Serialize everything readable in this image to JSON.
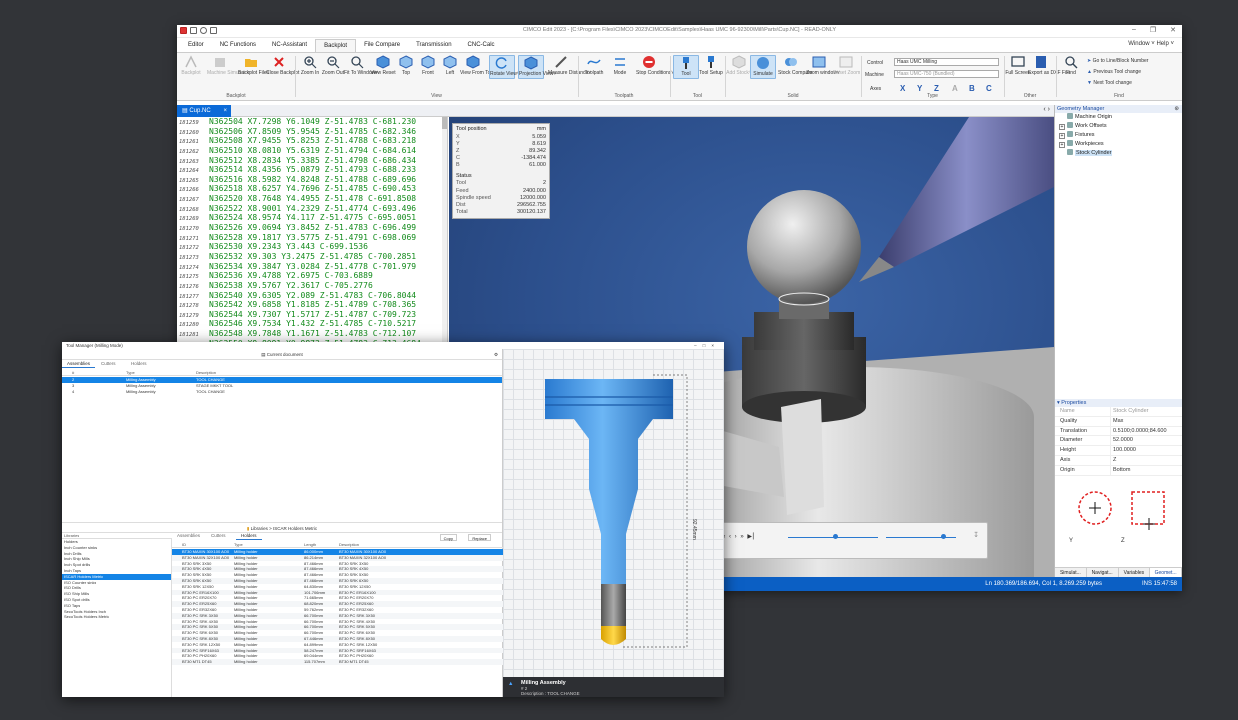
{
  "app": {
    "title": "CIMCO Edit 2023 - [C:\\Program Files\\CIMCO 2023\\CIMCOEdit\\Samples\\Haas UMC 96-92300\\Mill\\Parts\\Cup.NC] - READ-ONLY",
    "menu_tabs": [
      "Editor",
      "NC Functions",
      "NC-Assistant",
      "Backplot",
      "File Compare",
      "Transmission",
      "CNC-Calc"
    ],
    "active_tab": "Backplot",
    "menu_right": "Window ˅  Help ˅"
  },
  "ribbon": {
    "groups": [
      "Backplot",
      "View",
      "Toolpath",
      "Tool",
      "Solid",
      "Type",
      "Other",
      "Find"
    ],
    "buttons": [
      {
        "id": "backplot",
        "label": "Backplot",
        "dim": true
      },
      {
        "id": "machine-sim",
        "label": "Machine Simulation",
        "dim": true
      },
      {
        "id": "backplot-file",
        "label": "Backplot File˅"
      },
      {
        "id": "close-backplot",
        "label": "Close Backplot"
      },
      {
        "id": "zoom-in",
        "label": "Zoom In"
      },
      {
        "id": "zoom-out",
        "label": "Zoom Out"
      },
      {
        "id": "fit-window",
        "label": "Fit To Window˅"
      },
      {
        "id": "view-reset",
        "label": "View Reset"
      },
      {
        "id": "top",
        "label": "Top"
      },
      {
        "id": "front",
        "label": "Front"
      },
      {
        "id": "left",
        "label": "Left"
      },
      {
        "id": "view-from-tool",
        "label": "View From Tool"
      },
      {
        "id": "rotate-view",
        "label": "Rotate View˅"
      },
      {
        "id": "projection-view",
        "label": "Projection View˅"
      },
      {
        "id": "measure-distance",
        "label": "Measure Distance˅"
      },
      {
        "id": "toolpath",
        "label": "Toolpath"
      },
      {
        "id": "mode",
        "label": "Mode"
      },
      {
        "id": "stop-conditions",
        "label": "Stop Conditions˅"
      },
      {
        "id": "tool",
        "label": "Tool"
      },
      {
        "id": "tool-setup",
        "label": "Tool Setup"
      },
      {
        "id": "add-stock",
        "label": "Add Stock˅",
        "dim": true
      },
      {
        "id": "simulate",
        "label": "Simulate"
      },
      {
        "id": "stock-compare",
        "label": "Stock Compare"
      },
      {
        "id": "zoom-window",
        "label": "Zoom window˅"
      },
      {
        "id": "reset-zoom",
        "label": "Reset Zoom",
        "dim": true
      },
      {
        "id": "full-screen",
        "label": "Full Screen"
      },
      {
        "id": "export-dxf",
        "label": "Export as DXF File"
      },
      {
        "id": "find",
        "label": "Find"
      }
    ],
    "type": {
      "control_label": "Control",
      "control_value": "Haas UMC Milling",
      "machine_label": "Machine",
      "machine_value": "Haas UMC-750 (Bundled)",
      "axes_label": "Axes",
      "axes": [
        "X",
        "Y",
        "Z",
        "A",
        "B",
        "C"
      ]
    },
    "find_items": [
      "Go to Line/Block Number",
      "Previous Tool change",
      "Next Tool change"
    ]
  },
  "doc_tab": {
    "label": "Cup.NC",
    "close": "×",
    "nav": "‹  ›"
  },
  "editor": {
    "lines": [
      {
        "n": "181259",
        "code": "N362504 X7.7298 Y6.1049 Z-51.4783 C-681.230"
      },
      {
        "n": "181260",
        "code": "N362506 X7.8509 Y5.9545 Z-51.4785 C-682.346"
      },
      {
        "n": "181261",
        "code": "N362508 X7.9455 Y5.8253 Z-51.4788 C-683.218"
      },
      {
        "n": "181262",
        "code": "N362510 X8.0810 Y5.6319 Z-51.4794 C-684.614"
      },
      {
        "n": "181263",
        "code": "N362512 X8.2834 Y5.3385 Z-51.4798 C-686.434"
      },
      {
        "n": "181264",
        "code": "N362514 X8.4356 Y5.0879 Z-51.4793 C-688.233"
      },
      {
        "n": "181265",
        "code": "N362516 X8.5982 Y4.8248 Z-51.4788 C-689.696"
      },
      {
        "n": "181266",
        "code": "N362518 X8.6257 Y4.7696 Z-51.4785 C-690.453"
      },
      {
        "n": "181267",
        "code": "N362520 X8.7648 Y4.4955 Z-51.478 C-691.8508"
      },
      {
        "n": "181268",
        "code": "N362522 X8.9001 Y4.2329 Z-51.4774 C-693.496"
      },
      {
        "n": "181269",
        "code": "N362524 X8.9574 Y4.117 Z-51.4775 C-695.0051"
      },
      {
        "n": "181270",
        "code": "N362526 X9.0694 Y3.8452 Z-51.4783 C-696.499"
      },
      {
        "n": "181271",
        "code": "N362528 X9.1817 Y3.5775 Z-51.4791 C-698.069"
      },
      {
        "n": "181272",
        "code": "N362530 X9.2343 Y3.443 C-699.1536"
      },
      {
        "n": "181273",
        "code": "N362532 X9.303 Y3.2475 Z-51.4785 C-700.2851"
      },
      {
        "n": "181274",
        "code": "N362534 X9.3847 Y3.0284 Z-51.4778 C-701.979"
      },
      {
        "n": "181275",
        "code": "N362536 X9.4788 Y2.6975 C-703.6889"
      },
      {
        "n": "181276",
        "code": "N362538 X9.5767 Y2.3617 C-705.2776"
      },
      {
        "n": "181277",
        "code": "N362540 X9.6305 Y2.089 Z-51.4783 C-706.8044"
      },
      {
        "n": "181278",
        "code": "N362542 X9.6858 Y1.8185 Z-51.4789 C-708.365"
      },
      {
        "n": "181279",
        "code": "N362544 X9.7307 Y1.5717 Z-51.4787 C-709.723"
      },
      {
        "n": "181280",
        "code": "N362546 X9.7534 Y1.432 Z-51.4785 C-710.5217"
      },
      {
        "n": "181281",
        "code": "N362548 X9.7848 Y1.1671 Z-51.4783 C-712.107"
      },
      {
        "n": "181282",
        "code": "N362550 X9.8091 Y0.9873 Z-51.4783 C-713.4684"
      }
    ]
  },
  "tool_position": {
    "title": "Tool position",
    "unit": "mm",
    "rows": [
      {
        "k": "X",
        "v": "5.059"
      },
      {
        "k": "Y",
        "v": "8.619"
      },
      {
        "k": "Z",
        "v": "89.342"
      },
      {
        "k": "C",
        "v": "-1384.474"
      },
      {
        "k": "B",
        "v": "61.000"
      }
    ],
    "status_title": "Status",
    "status_rows": [
      {
        "k": "Tool",
        "v": "2"
      },
      {
        "k": "Feed",
        "v": "2400.000"
      },
      {
        "k": "Spindle speed",
        "v": "12000.000"
      },
      {
        "k": "Dist",
        "v": "296562.755"
      },
      {
        "k": "Total",
        "v": "300120.137"
      }
    ]
  },
  "player": {
    "controls": "«  ‹  ›  »  ▶▏",
    "progress": 0.52,
    "speed": 0.82
  },
  "geometry_manager": {
    "title": "Geometry Manager",
    "items": [
      {
        "label": "Machine Origin",
        "exp": ""
      },
      {
        "label": "Work Offsets",
        "exp": "+"
      },
      {
        "label": "Fixtures",
        "exp": "+"
      },
      {
        "label": "Workpieces",
        "exp": "+"
      },
      {
        "label": "Stock Cylinder",
        "exp": "",
        "sel": true
      }
    ]
  },
  "properties": {
    "title": "Properties",
    "rows": [
      {
        "k": "Name",
        "v": "Stock Cylinder",
        "dim": true
      },
      {
        "k": "Quality",
        "v": "Max"
      },
      {
        "k": "Translation",
        "v": "0.5100;0.0000;84.600"
      },
      {
        "k": "Diameter",
        "v": "52.0000"
      },
      {
        "k": "Height",
        "v": "100.0000"
      },
      {
        "k": "Axis",
        "v": "Z"
      },
      {
        "k": "Origin",
        "v": "Bottom"
      }
    ],
    "tabs": [
      "Simulat...",
      "Navigat...",
      "Variables",
      "Geomet..."
    ]
  },
  "statusbar": {
    "position": "Ln 180.369/186.694, Col 1, 8.269.259 bytes",
    "mode": "INS",
    "time": "15:47:58"
  },
  "tool_manager": {
    "title": "Tool Manager (Milling Mode)",
    "current_doc": "Current document",
    "tabs": [
      "Assemblies",
      "Cutters",
      "Holders"
    ],
    "headers": [
      "#",
      "Type",
      "Description"
    ],
    "rows": [
      {
        "n": "2",
        "type": "Milling Assembly",
        "desc": "TOOL CHANGE",
        "sel": true
      },
      {
        "n": "3",
        "type": "Milling Assembly",
        "desc": "STAGE MKKT TOOL"
      },
      {
        "n": "4",
        "type": "Milling Assembly",
        "desc": "TOOL CHANGE"
      }
    ],
    "lib_path": "Libraries > ISCAR Holders Metric",
    "lib_title": "Libraries",
    "lib_items": [
      "Holders",
      "Inch Counter sinks",
      "Inch Drills",
      "Inch Ship Mills",
      "Inch Spot drills",
      "Inch Taps",
      "ISCAR Holders Metric",
      "ISO Counter sinks",
      "ISO Drills",
      "ISO Ship Mills",
      "ISO Spot drills",
      "ISO Taps",
      "SecoTools Holders Inch",
      "SecoTools Holders Metric"
    ],
    "lib_selected": 6,
    "lib_tabs": [
      "Assemblies",
      "Cutters",
      "Holders"
    ],
    "btn_copy": "Copy",
    "btn_replace": "Replace",
    "lib_headers": [
      "ID",
      "Type",
      "Length",
      "Description"
    ],
    "lib_rows": [
      {
        "id": "BT30 MAXIN 30X100 AO0",
        "type": "Milling holder",
        "len": "86.000mm",
        "desc": "BT30 MAXIN 30X100 AO0",
        "sel": true
      },
      {
        "id": "BT30 MAXIN 32X100 AO0",
        "type": "Milling holder",
        "len": "86.214mm",
        "desc": "BT30 MAXIN 32X100 AO0"
      },
      {
        "id": "BT30 SRK 3X50",
        "type": "Milling holder",
        "len": "87.466mm",
        "desc": "BT30 SRK 3X50"
      },
      {
        "id": "BT30 SRK 4X50",
        "type": "Milling holder",
        "len": "87.466mm",
        "desc": "BT30 SRK 4X50"
      },
      {
        "id": "BT30 SRK 5X50",
        "type": "Milling holder",
        "len": "87.466mm",
        "desc": "BT30 SRK 5X50"
      },
      {
        "id": "BT30 SRK 6X50",
        "type": "Milling holder",
        "len": "87.466mm",
        "desc": "BT30 SRK 6X50"
      },
      {
        "id": "BT30 SRK 12X50",
        "type": "Milling holder",
        "len": "64.830mm",
        "desc": "BT30 SRK 12X50"
      },
      {
        "id": "BT30 PC ER16X100",
        "type": "Milling holder",
        "len": "101.706mm",
        "desc": "BT30 PC ER16X100"
      },
      {
        "id": "BT30 PC ER20X70",
        "type": "Milling holder",
        "len": "71.665mm",
        "desc": "BT30 PC ER20X70"
      },
      {
        "id": "BT30 PC ER25X60",
        "type": "Milling holder",
        "len": "68.820mm",
        "desc": "BT30 PC ER25X60"
      },
      {
        "id": "BT30 PC ER32X60",
        "type": "Milling holder",
        "len": "59.762mm",
        "desc": "BT30 PC ER32X60"
      },
      {
        "id": "BT30 PC SRK 3X50",
        "type": "Milling holder",
        "len": "66.700mm",
        "desc": "BT30 PC SRK 3X50"
      },
      {
        "id": "BT30 PC SRK 4X50",
        "type": "Milling holder",
        "len": "66.700mm",
        "desc": "BT30 PC SRK 4X50"
      },
      {
        "id": "BT30 PC SRK 5X50",
        "type": "Milling holder",
        "len": "66.700mm",
        "desc": "BT30 PC SRK 5X50"
      },
      {
        "id": "BT30 PC SRK 6X50",
        "type": "Milling holder",
        "len": "66.700mm",
        "desc": "BT30 PC SRK 6X50"
      },
      {
        "id": "BT30 PC SRK 8X50",
        "type": "Milling holder",
        "len": "67.446mm",
        "desc": "BT30 PC SRK 8X50"
      },
      {
        "id": "BT30 PC SRK 12X50",
        "type": "Milling holder",
        "len": "64.899mm",
        "desc": "BT30 PC SRK 12X50"
      },
      {
        "id": "BT30 PC SRF16X63",
        "type": "Milling holder",
        "len": "58.247mm",
        "desc": "BT30 PC SRF16X63"
      },
      {
        "id": "BT30 PC PH20X60",
        "type": "Milling holder",
        "len": "69.044mm",
        "desc": "BT30 PC PH20X60"
      },
      {
        "id": "BT30 MT1 DT45",
        "type": "Milling holder",
        "len": "115.707mm",
        "desc": "BT30 MT1 DT45"
      }
    ],
    "dim_label": "92.45mm",
    "footer_title": "Milling Assembly",
    "footer_num": "# 2",
    "footer_desc": "Description : TOOL CHANGE"
  }
}
